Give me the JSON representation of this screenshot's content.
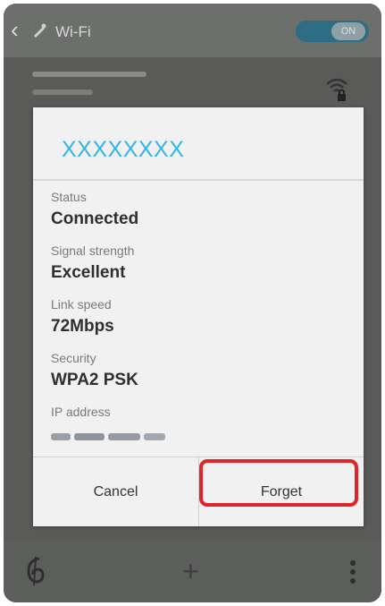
{
  "header": {
    "back_icon": "chevron-left",
    "title": "Wi-Fi",
    "toggle_label": "ON"
  },
  "dialog": {
    "title": "XXXXXXXX",
    "fields": [
      {
        "label": "Status",
        "value": "Connected"
      },
      {
        "label": "Signal strength",
        "value": "Excellent"
      },
      {
        "label": "Link speed",
        "value": "72Mbps"
      },
      {
        "label": "Security",
        "value": "WPA2 PSK"
      },
      {
        "label": "IP address",
        "value": ""
      }
    ],
    "cancel_label": "Cancel",
    "forget_label": "Forget"
  },
  "bottom_bar": {
    "add_icon": "+"
  },
  "colors": {
    "accent": "#33b5e5",
    "highlight": "#e0242a",
    "toggle": "#2e6e84"
  }
}
